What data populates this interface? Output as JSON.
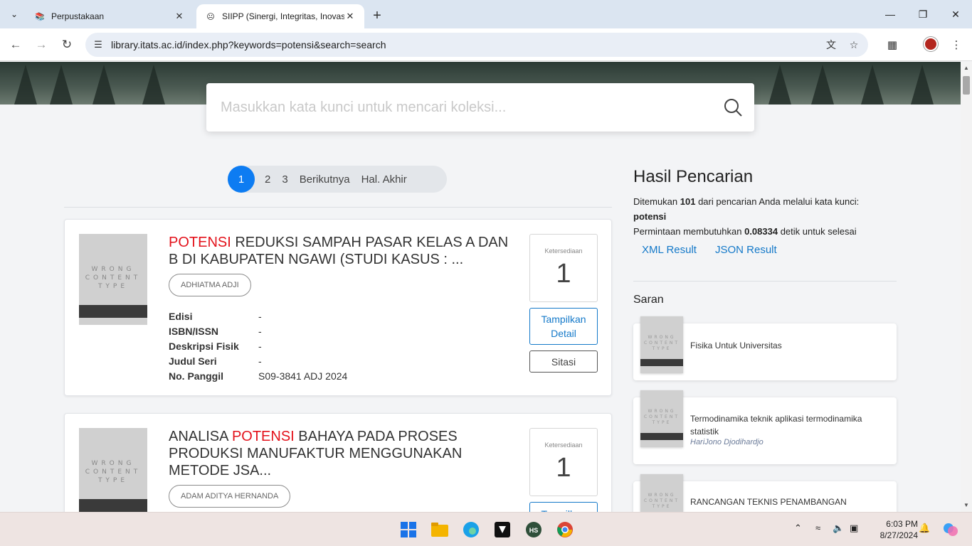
{
  "browser": {
    "tabs": [
      {
        "title": "Perpustakaan",
        "active": false
      },
      {
        "title": "SIIPP (Sinergi, Integritas, Inovasi",
        "active": true
      }
    ],
    "url": "library.itats.ac.id/index.php?keywords=potensi&search=search"
  },
  "search": {
    "placeholder": "Masukkan kata kunci untuk mencari koleksi..."
  },
  "pagination": {
    "pages": [
      "1",
      "2",
      "3"
    ],
    "current": "1",
    "next": "Berikutnya",
    "last": "Hal. Akhir"
  },
  "cover_placeholder": "WRONG CONTENT TYPE",
  "results": [
    {
      "title_highlight": "POTENSI",
      "title_rest": " REDUKSI SAMPAH PASAR KELAS A DAN B DI KABUPATEN NGAWI (STUDI KASUS : ...",
      "author": "ADHIATMA ADJI",
      "meta": [
        {
          "key": "Edisi",
          "value": "-"
        },
        {
          "key": "ISBN/ISSN",
          "value": "-"
        },
        {
          "key": "Deskripsi Fisik",
          "value": "-"
        },
        {
          "key": "Judul Seri",
          "value": "-"
        },
        {
          "key": "No. Panggil",
          "value": "S09-3841 ADJ 2024"
        }
      ],
      "availability_label": "Ketersediaan",
      "availability": "1",
      "detail_label": "Tampilkan Detail",
      "cite_label": "Sitasi"
    },
    {
      "title_prefix": "ANALISA ",
      "title_highlight": "POTENSI",
      "title_rest": " BAHAYA PADA PROSES PRODUKSI MANUFAKTUR MENGGUNAKAN METODE JSA...",
      "author": "ADAM ADITYA HERNANDA",
      "availability_label": "Ketersediaan",
      "availability": "1",
      "detail_label": "Tampilkan"
    }
  ],
  "sidebar": {
    "title": "Hasil Pencarian",
    "found_prefix": "Ditemukan ",
    "found_count": "101",
    "found_suffix": " dari pencarian Anda melalui kata kunci:",
    "keyword": "potensi",
    "time_prefix": "Permintaan membutuhkan ",
    "time_value": "0.08334",
    "time_suffix": " detik untuk selesai",
    "xml_link": "XML Result",
    "json_link": "JSON Result",
    "suggestions_title": "Saran",
    "suggestions": [
      {
        "title": "Fisika Untuk Universitas",
        "author": ""
      },
      {
        "title": "Termodinamika teknik aplikasi termodinamika statistik",
        "author": "HariJono Djodihardjo"
      },
      {
        "title": "RANCANGAN TEKNIS PENAMBANGAN",
        "author": ""
      }
    ]
  },
  "taskbar": {
    "time": "6:03 PM",
    "date": "8/27/2024"
  }
}
